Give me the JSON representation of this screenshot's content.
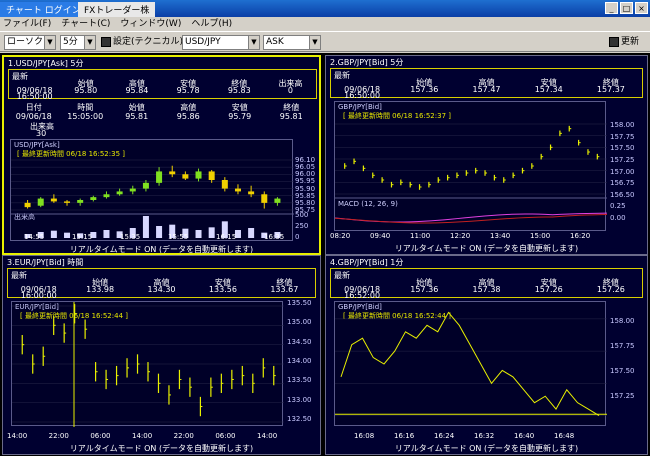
{
  "titlebar": {
    "tab1": "チャート ログイン",
    "tab2": "FXトレーダー株"
  },
  "menu": [
    "ファイル(F)",
    "チャート(C)",
    "ウィンドウ(W)",
    "ヘルプ(H)"
  ],
  "toolbar": {
    "chart_type": "ローソク",
    "interval": "5分",
    "settings": "設定(テクニカル)",
    "pair": "USD/JPY",
    "side": "ASK",
    "refresh": "更新"
  },
  "footer_text": "リアルタイムモード ON (データを自動更新します)",
  "panels": {
    "p1": {
      "title": "1.USD/JPY[Ask]  5分",
      "latest": "最新",
      "headers": [
        "",
        "始値",
        "高値",
        "安値",
        "終値",
        "出来高"
      ],
      "row1": [
        "09/06/18",
        "95.80",
        "95.84",
        "95.78",
        "95.83",
        "0"
      ],
      "row1b": [
        "16:50:00",
        "",
        "",
        "",
        "",
        ""
      ],
      "headers2": [
        "日付",
        "時間",
        "始値",
        "高値",
        "安値",
        "終値"
      ],
      "row2": [
        "09/06/18",
        "15:05:00",
        "95.81",
        "95.86",
        "95.79",
        "95.81"
      ],
      "vol_label": "出来高",
      "vol_value": "30",
      "chart_title": "USD/JPY[Ask]",
      "chart_updated": "[ 最終更新時間 06/18 16:52:35 ]",
      "vol_chart_label": "出来高",
      "yticks": [
        "96.10",
        "96.05",
        "96.00",
        "95.95",
        "95.90",
        "95.85",
        "95.80",
        "95.75"
      ],
      "vticks": [
        "500",
        "250",
        "0"
      ],
      "xticks": [
        "14:55",
        "15:15",
        "15:35",
        "15:55",
        "16:15",
        "16:35"
      ]
    },
    "p2": {
      "title": "2.GBP/JPY[Bid]  5分",
      "latest": "最新",
      "headers": [
        "",
        "始値",
        "高値",
        "安値",
        "終値"
      ],
      "row1": [
        "09/06/18",
        "157.36",
        "157.47",
        "157.34",
        "157.37"
      ],
      "row1b": [
        "16:50:00",
        "",
        "",
        "",
        ""
      ],
      "chart_title": "GBP/JPY[Bid]",
      "chart_updated": "[ 最終更新時間 06/18 16:52:37 ]",
      "macd_label": "MACD (12, 26, 9)",
      "yticks": [
        "158.00",
        "157.75",
        "157.50",
        "157.25",
        "157.00",
        "156.75",
        "156.50"
      ],
      "macd_ticks": [
        "0.25",
        "0.00"
      ],
      "xticks": [
        "08:20",
        "09:40",
        "11:00",
        "12:20",
        "13:40",
        "15:00",
        "16:20"
      ]
    },
    "p3": {
      "title": "3.EUR/JPY[Bid]  時間",
      "latest": "最新",
      "headers": [
        "",
        "始値",
        "高値",
        "安値",
        "終値"
      ],
      "row1": [
        "09/06/18",
        "133.98",
        "134.30",
        "133.56",
        "133.67"
      ],
      "row1b": [
        "16:00:00",
        "",
        "",
        "",
        ""
      ],
      "chart_title": "EUR/JPY[Bid]",
      "chart_updated": "[ 最終更新時間 06/18 16:52:44 ]",
      "yticks": [
        "135.50",
        "135.00",
        "134.50",
        "134.00",
        "133.50",
        "133.00",
        "132.50"
      ],
      "xticks": [
        "14:00",
        "22:00",
        "06:00",
        "14:00",
        "22:00",
        "06:00",
        "14:00"
      ]
    },
    "p4": {
      "title": "4.GBP/JPY[Bid]  1分",
      "latest": "最新",
      "headers": [
        "",
        "始値",
        "高値",
        "安値",
        "終値"
      ],
      "row1": [
        "09/06/18",
        "157.36",
        "157.38",
        "157.26",
        "157.26"
      ],
      "row1b": [
        "16:52:00",
        "",
        "",
        "",
        ""
      ],
      "chart_title": "GBP/JPY[Bid]",
      "chart_updated": "[ 最終更新時間 06/18 16:52:44 ]",
      "yticks": [
        "158.00",
        "157.75",
        "157.50",
        "157.25"
      ],
      "xticks": [
        "16:08",
        "16:16",
        "16:24",
        "16:32",
        "16:40",
        "16:48"
      ]
    }
  },
  "colors": {
    "bg": "#000030",
    "frame": "#d8d000",
    "up": "#80e020",
    "down": "#f0d000",
    "line": "#e8f000",
    "volume": "#d8d8ff",
    "macd1": "#e040e0",
    "macd2": "#c02020",
    "active": "#e8f000"
  },
  "chart_data": [
    {
      "type": "candlestick",
      "series": [
        {
          "name": "USD/JPY[Ask]",
          "values": [
            [
              95.8,
              95.82,
              95.76,
              95.77
            ],
            [
              95.78,
              95.84,
              95.77,
              95.83
            ],
            [
              95.83,
              95.86,
              95.8,
              95.81
            ],
            [
              95.81,
              95.82,
              95.78,
              95.8
            ],
            [
              95.8,
              95.83,
              95.78,
              95.82
            ],
            [
              95.82,
              95.85,
              95.81,
              95.84
            ],
            [
              95.84,
              95.88,
              95.83,
              95.86
            ],
            [
              95.86,
              95.9,
              95.85,
              95.88
            ],
            [
              95.88,
              95.92,
              95.86,
              95.9
            ],
            [
              95.9,
              95.96,
              95.88,
              95.94
            ],
            [
              95.94,
              96.05,
              95.92,
              96.02
            ],
            [
              96.02,
              96.06,
              95.98,
              96.0
            ],
            [
              96.0,
              96.02,
              95.96,
              95.97
            ],
            [
              95.97,
              96.04,
              95.95,
              96.02
            ],
            [
              96.02,
              96.03,
              95.94,
              95.96
            ],
            [
              95.96,
              95.98,
              95.88,
              95.9
            ],
            [
              95.9,
              95.93,
              95.86,
              95.88
            ],
            [
              95.88,
              95.92,
              95.84,
              95.86
            ],
            [
              95.86,
              95.88,
              95.76,
              95.8
            ],
            [
              95.8,
              95.84,
              95.78,
              95.83
            ]
          ]
        }
      ],
      "volume": [
        60,
        90,
        110,
        80,
        70,
        90,
        120,
        100,
        150,
        330,
        180,
        200,
        140,
        120,
        160,
        250,
        120,
        150,
        80,
        90
      ],
      "ylim": [
        95.75,
        96.1
      ]
    },
    {
      "type": "line",
      "series": [
        {
          "name": "GBP/JPY[Bid]",
          "values": [
            157.1,
            157.2,
            157.05,
            156.9,
            156.8,
            156.7,
            156.75,
            156.7,
            156.65,
            156.7,
            156.8,
            156.85,
            156.9,
            156.95,
            157.0,
            156.95,
            156.85,
            156.8,
            156.9,
            157.0,
            157.1,
            157.3,
            157.5,
            157.8,
            157.9,
            157.6,
            157.4,
            157.3
          ]
        }
      ],
      "ylim": [
        156.5,
        158.0
      ]
    },
    {
      "type": "line",
      "series": [
        {
          "name": "EUR/JPY[Bid]",
          "values": [
            134.5,
            134.0,
            134.2,
            135.0,
            134.8,
            135.3,
            134.9,
            133.8,
            133.6,
            133.7,
            133.9,
            134.0,
            133.8,
            133.5,
            133.2,
            133.6,
            133.4,
            132.9,
            133.4,
            133.5,
            133.6,
            133.7,
            133.5,
            133.9,
            133.7
          ]
        }
      ],
      "ylim": [
        132.5,
        135.5
      ]
    },
    {
      "type": "line",
      "series": [
        {
          "name": "GBP/JPY[Bid]",
          "values": [
            157.55,
            157.8,
            157.85,
            157.7,
            157.65,
            157.75,
            157.9,
            157.85,
            157.95,
            157.9,
            158.05,
            157.95,
            157.8,
            157.65,
            157.5,
            157.6,
            157.55,
            157.45,
            157.35,
            157.4,
            157.3,
            157.45,
            157.35,
            157.3,
            157.25
          ]
        }
      ],
      "ylim": [
        157.2,
        158.1
      ]
    }
  ]
}
